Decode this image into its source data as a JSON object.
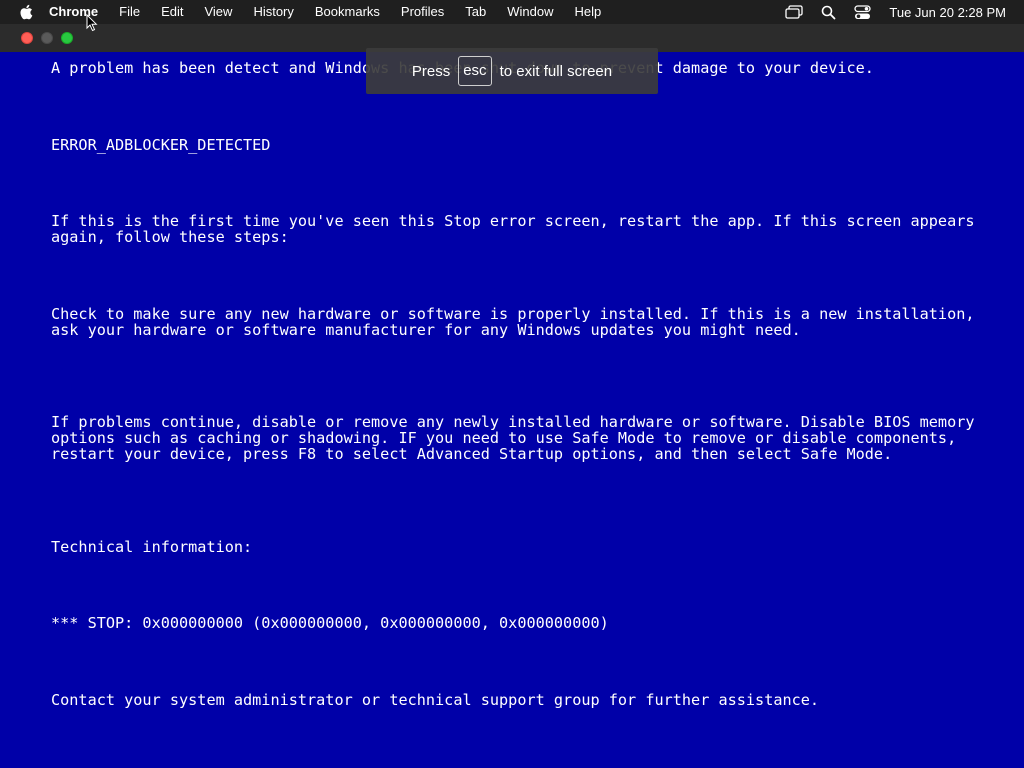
{
  "menubar": {
    "app_name": "Chrome",
    "items": [
      "File",
      "Edit",
      "View",
      "History",
      "Bookmarks",
      "Profiles",
      "Tab",
      "Window",
      "Help"
    ],
    "icons": [
      "apple-logo-icon",
      "screen-mirroring-icon",
      "spotlight-search-icon",
      "control-center-icon"
    ],
    "clock": "Tue Jun 20  2:28 PM"
  },
  "toast": {
    "prefix": "Press",
    "key": "esc",
    "suffix": "to exit full screen"
  },
  "bsod": {
    "background_color": "#0000a8",
    "line1": "A problem has been detect and Windows has been shut down to prevent damage to your device.",
    "error_code": "ERROR_ADBLOCKER_DETECTED",
    "para1": "If this is the first time you've seen this Stop error screen, restart the app. If this screen appears again, follow these steps:",
    "para2": "Check to make sure any new hardware or software is properly installed. If this is a new installation, ask your hardware or software manufacturer for any Windows updates you might need.",
    "para3": "If problems continue, disable or remove any newly installed hardware or software. Disable BIOS memory options such as caching or shadowing. IF you need to use Safe Mode to remove or disable components, restart your device, press F8 to select Advanced Startup options, and then select Safe Mode.",
    "tech_heading": "Technical information:",
    "stop_line": "*** STOP: 0x000000000 (0x000000000, 0x000000000, 0x000000000)",
    "contact": "Contact your system administrator or technical support group for further assistance."
  }
}
